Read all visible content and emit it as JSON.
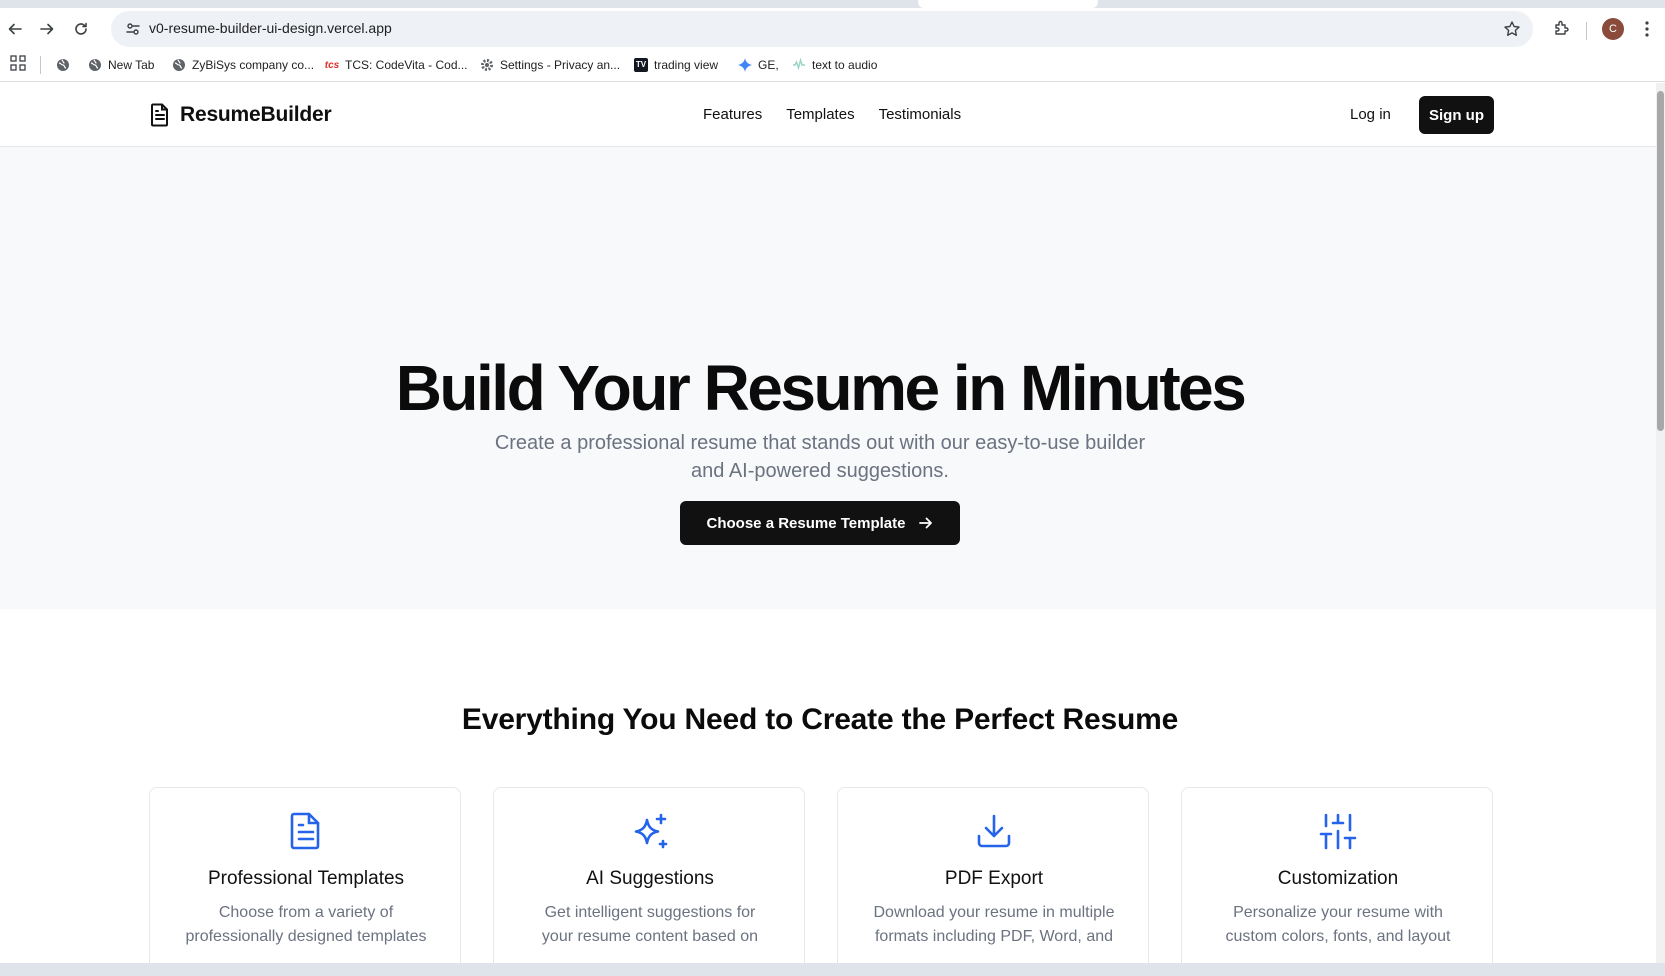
{
  "browser": {
    "url": "v0-resume-builder-ui-design.vercel.app",
    "profile_initial": "C",
    "bookmarks": [
      {
        "label": "",
        "icon": "globe-icon"
      },
      {
        "label": "New Tab",
        "icon": "globe-icon"
      },
      {
        "label": "ZyBiSys company co...",
        "icon": "globe-icon"
      },
      {
        "label": "TCS: CodeVita - Cod...",
        "icon": "tcs-logo-icon"
      },
      {
        "label": "Settings - Privacy an...",
        "icon": "gear-icon"
      },
      {
        "label": "trading view",
        "icon": "tradingview-logo-icon"
      },
      {
        "label": "GE,",
        "icon": "sparkle-icon"
      },
      {
        "label": "text to audio",
        "icon": "audio-wave-icon"
      }
    ]
  },
  "header": {
    "brand": "ResumeBuilder",
    "nav": [
      "Features",
      "Templates",
      "Testimonials"
    ],
    "login": "Log in",
    "signup": "Sign up"
  },
  "hero": {
    "title": "Build Your Resume in Minutes",
    "subtitle_line1": "Create a professional resume that stands out with our easy-to-use builder",
    "subtitle_line2": "and AI-powered suggestions.",
    "cta": "Choose a Resume Template"
  },
  "features": {
    "title": "Everything You Need to Create the Perfect Resume",
    "accent_color": "#2563eb",
    "cards": [
      {
        "title": "Professional Templates",
        "icon": "document-icon",
        "desc_line1": "Choose from a variety of",
        "desc_line2": "professionally designed templates"
      },
      {
        "title": "AI Suggestions",
        "icon": "sparkles-icon",
        "desc_line1": "Get intelligent suggestions for",
        "desc_line2": "your resume content based on"
      },
      {
        "title": "PDF Export",
        "icon": "download-icon",
        "desc_line1": "Download your resume in multiple",
        "desc_line2": "formats including PDF, Word, and"
      },
      {
        "title": "Customization",
        "icon": "sliders-icon",
        "desc_line1": "Personalize your resume with",
        "desc_line2": "custom colors, fonts, and layout"
      }
    ]
  }
}
